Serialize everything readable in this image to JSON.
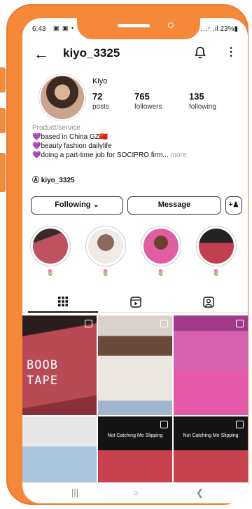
{
  "status_bar": {
    "time": "6:43",
    "icons": "▣ ▣ •",
    "battery": "…↑ .ıl 23%▮"
  },
  "header": {
    "username": "kiyo_3325",
    "back_icon": "arrow-left-icon",
    "notify_icon": "bell-icon",
    "more_icon": "more-vertical-icon"
  },
  "profile": {
    "display_name": "Kiyo",
    "stats": [
      {
        "value": "72",
        "label": "posts"
      },
      {
        "value": "765",
        "label": "followers"
      },
      {
        "value": "135",
        "label": "following"
      }
    ],
    "category": "Product/service",
    "bio_lines": [
      "💜based in China GZ🇨🇳",
      "💜beauty fashion dailylife",
      "💜doing a part-time job for SOCIPRO firm..."
    ],
    "bio_more": "more",
    "threads_handle": "kiyo_3325"
  },
  "actions": {
    "following_label": "Following ⌄",
    "message_label": "Message",
    "add_person_icon": "add-person-icon"
  },
  "highlights": [
    {
      "label": "🌷",
      "color": "#c0525f"
    },
    {
      "label": "🌷",
      "color": "#8b6a5a"
    },
    {
      "label": "🌷",
      "color": "#e05ea0"
    },
    {
      "label": "🌷",
      "color": "#4a3a3a"
    }
  ],
  "tabs": [
    {
      "name": "grid-icon",
      "active": true
    },
    {
      "name": "reels-icon",
      "active": false
    },
    {
      "name": "tagged-icon",
      "active": false
    }
  ],
  "grid": {
    "tile1_text": "BOOB\nTAPE",
    "tile_caption": "Not Catching Me Slipping"
  },
  "colors": {
    "accent_frame": "#f6883a",
    "text": "#111111",
    "tab_active": "#111111"
  }
}
